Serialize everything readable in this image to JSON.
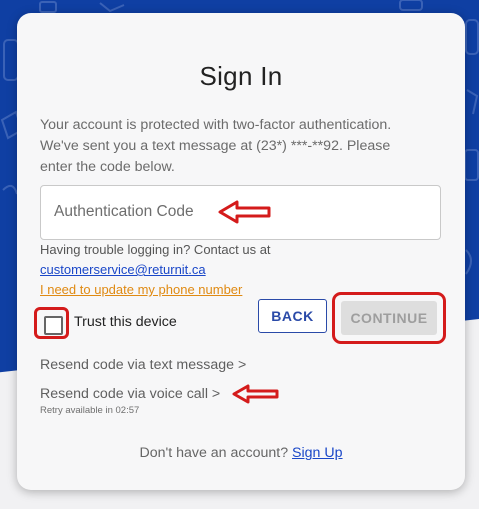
{
  "colors": {
    "background_blue": "#0f3fa3",
    "card": "#f7f7f8",
    "annotation_red": "#d41b1b",
    "link_blue": "#1a47c8",
    "link_orange": "#e08a12"
  },
  "form": {
    "title": "Sign In",
    "description": "Your account is protected with two-factor authentication. We've sent you a text message at (23*) ***-**92. Please enter the code below.",
    "code_placeholder": "Authentication Code",
    "trouble_text": "Having trouble logging in? Contact us at",
    "support_email": "customerservice@returnit.ca",
    "update_phone_link": "I need to update my phone number",
    "trust_label": "Trust this device",
    "back_label": "BACK",
    "continue_label": "CONTINUE",
    "resend_text_label": "Resend code via text message >",
    "resend_voice_label": "Resend code via voice call >",
    "retry_text": "Retry available in 02:57",
    "no_account_text": "Don't have an account?",
    "signup_label": "Sign Up"
  },
  "icons": {
    "annotation_arrow": "left-arrow-icon",
    "checkbox": "checkbox-icon"
  }
}
